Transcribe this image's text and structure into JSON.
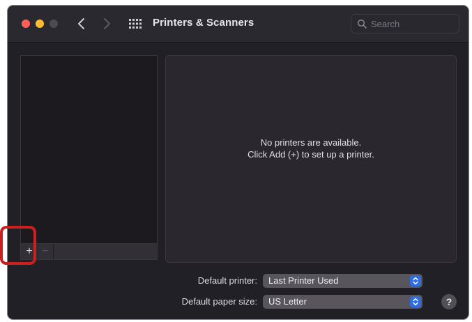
{
  "window": {
    "title": "Printers & Scanners"
  },
  "titlebar": {
    "search_placeholder": "Search",
    "icons": [
      "chevron-left-icon",
      "chevron-right-icon",
      "grid-icon",
      "search-icon"
    ]
  },
  "printer_list": {
    "add_label": "+",
    "remove_label": "−"
  },
  "detail": {
    "empty_line1": "No printers are available.",
    "empty_line2": "Click Add (+) to set up a printer."
  },
  "settings": {
    "default_printer_label": "Default printer:",
    "default_printer_value": "Last Printer Used",
    "paper_size_label": "Default paper size:",
    "paper_size_value": "US Letter"
  },
  "help": {
    "label": "?"
  },
  "colors": {
    "annotation": "#cc1f1f",
    "popup_accent": "#2d6ee6",
    "traffic_close": "#fe5f57",
    "traffic_minimize": "#febc2e"
  }
}
